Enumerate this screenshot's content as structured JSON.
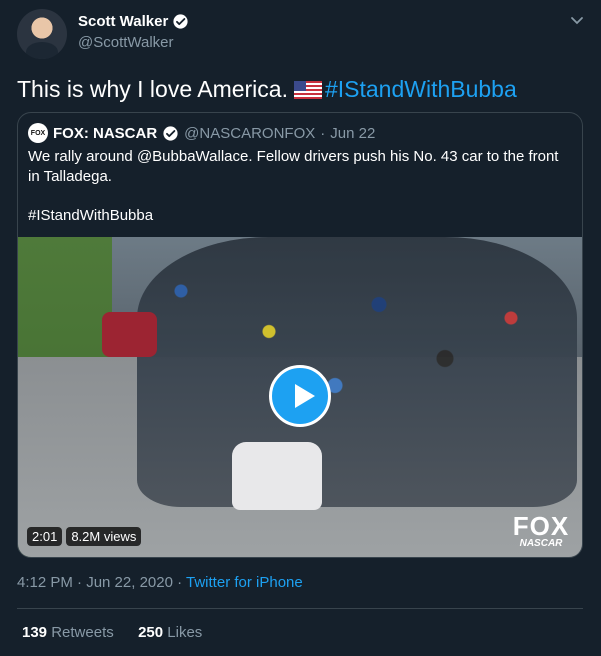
{
  "author": {
    "name": "Scott Walker",
    "handle": "@ScottWalker"
  },
  "tweet": {
    "text_before": "This is why I love America.",
    "flag_icon": "us-flag-icon",
    "hashtag": "#IStandWithBubba"
  },
  "quoted": {
    "avatar_text": "FOX",
    "name": "FOX: NASCAR",
    "handle": "@NASCARONFOX",
    "separator": "·",
    "date": "Jun 22",
    "text": "We rally around @BubbaWallace. Fellow drivers push his No. 43 car to the front in Talladega.",
    "hashtag": "#IStandWithBubba",
    "video": {
      "duration": "2:01",
      "views": "8.2M views",
      "logo_line1": "FOX",
      "logo_line2": "NASCAR"
    }
  },
  "meta": {
    "time": "4:12 PM · Jun 22, 2020 ·",
    "source": "Twitter for iPhone"
  },
  "stats": {
    "retweets_count": "139",
    "retweets_label": "Retweets",
    "likes_count": "250",
    "likes_label": "Likes"
  },
  "colors": {
    "background": "#15202b",
    "accent": "#1da1f2",
    "muted": "#8899a6"
  }
}
